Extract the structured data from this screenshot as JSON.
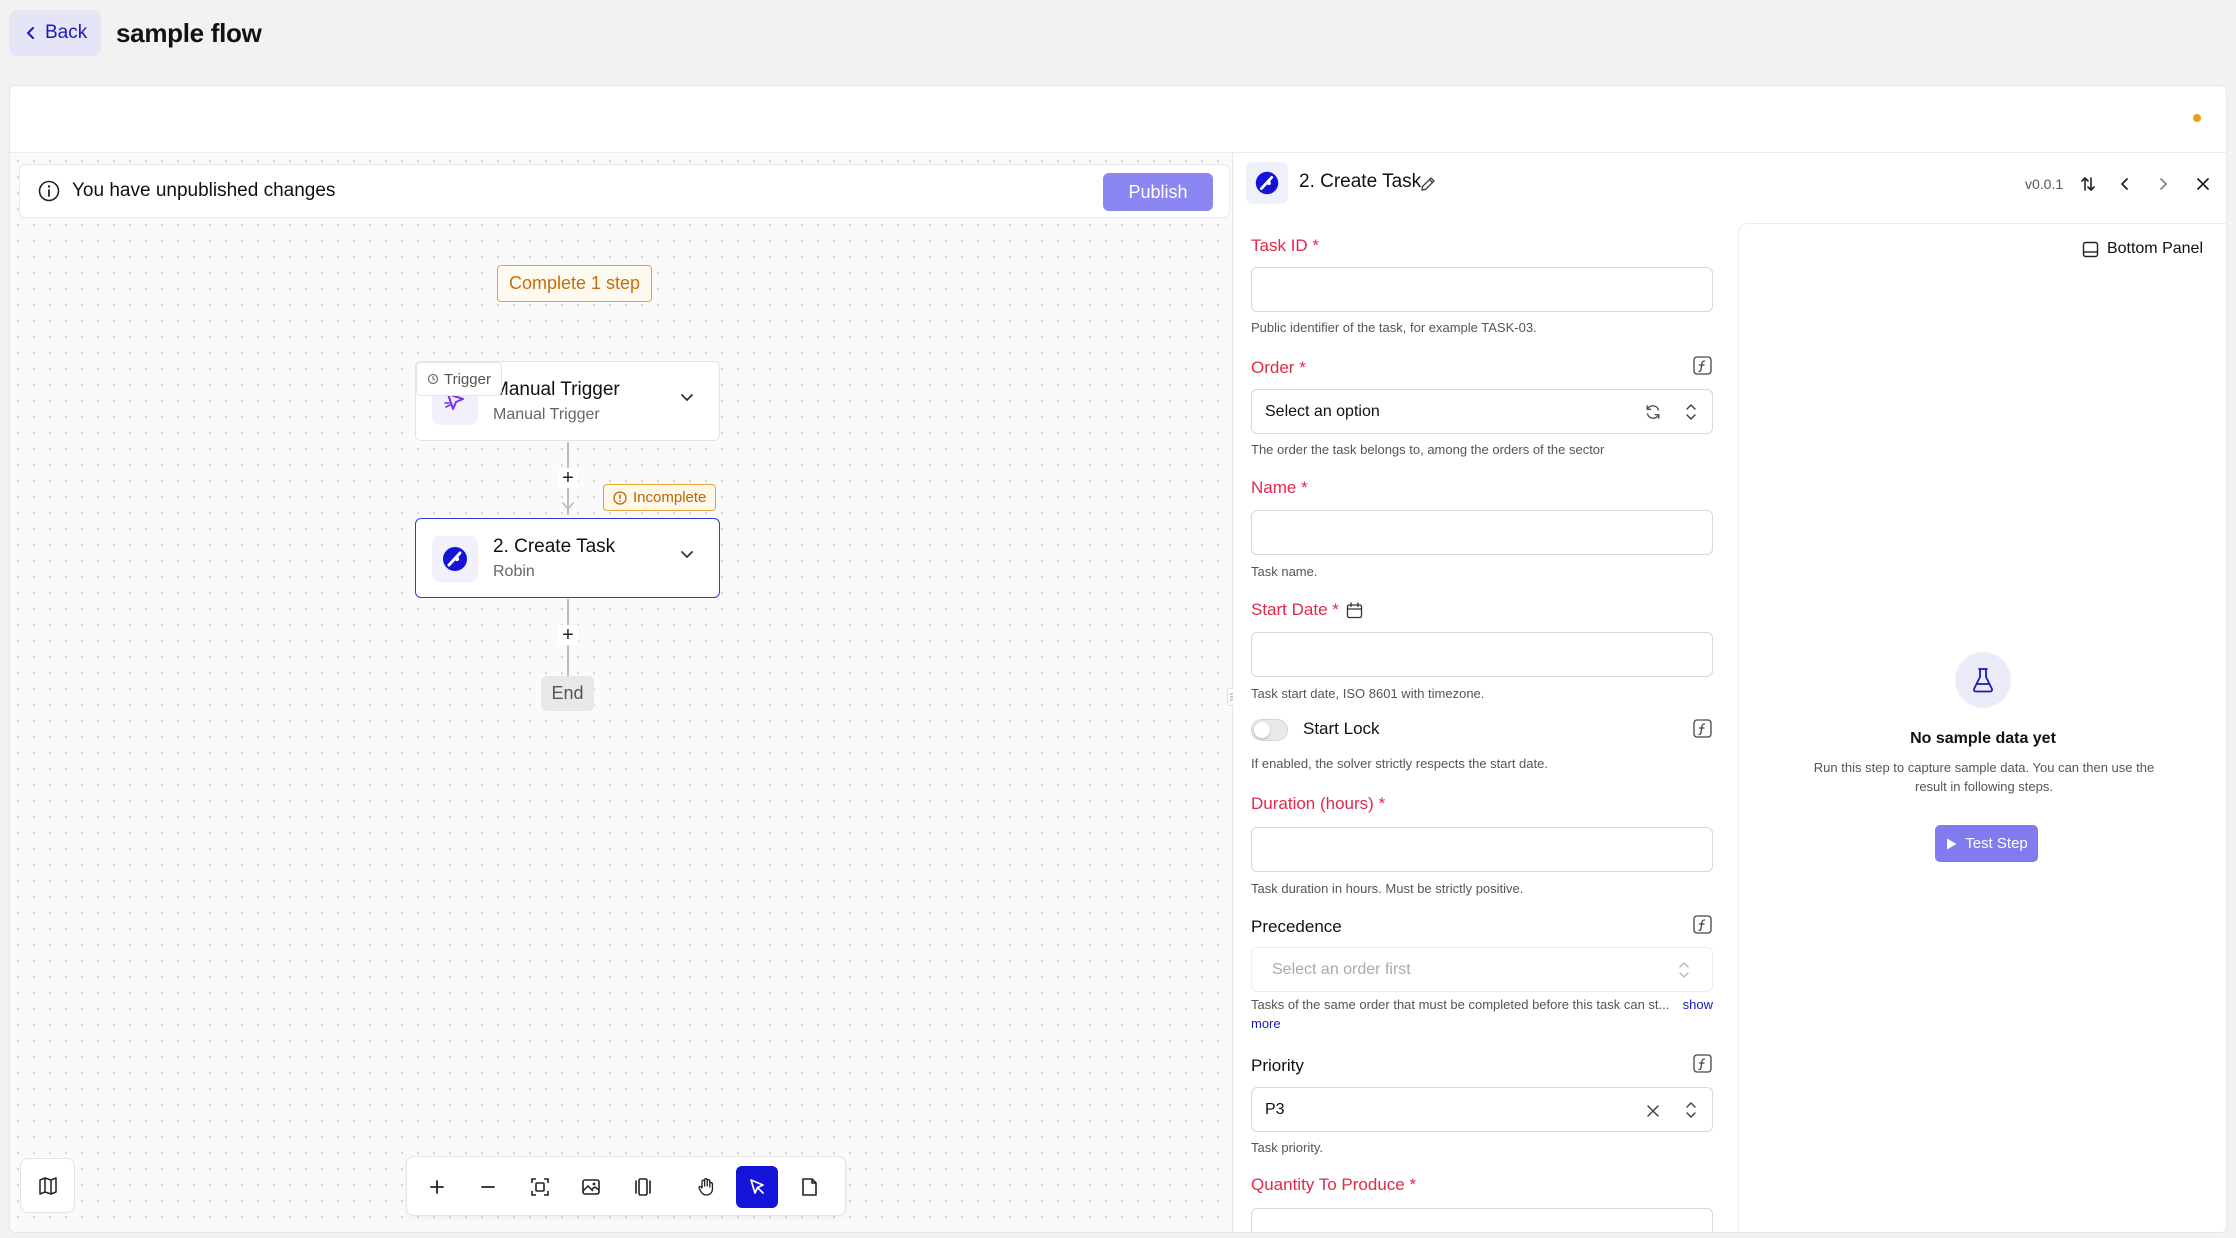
{
  "header": {
    "back_label": "Back",
    "flow_title": "sample flow"
  },
  "colors": {
    "accent": "#1414d9",
    "publish": "#8a86f2",
    "warning": "#e8a317",
    "required": "#e0294b"
  },
  "canvas": {
    "banner_text": "You have unpublished changes",
    "publish_label": "Publish",
    "complete_tag": "Complete 1 step",
    "trigger_node": {
      "tag": "Trigger",
      "title": "Manual Trigger",
      "subtitle": "Manual Trigger"
    },
    "step_node": {
      "title": "2. Create Task",
      "subtitle": "Robin",
      "status": "Incomplete"
    },
    "end_label": "End",
    "add_step_glyph": "+",
    "toolbar_icons": [
      "zoom-in-icon",
      "zoom-out-icon",
      "fit-view-icon",
      "export-image-icon",
      "layout-icon",
      "pan-hand-icon",
      "select-pointer-icon",
      "note-icon"
    ],
    "selected_tool": "select-pointer"
  },
  "panel": {
    "step_title": "2. Create Task",
    "version": "v0.0.1",
    "fields": {
      "task_id": {
        "label": "Task ID",
        "required_mark": "*",
        "value": "",
        "help": "Public identifier of the task, for example TASK-03."
      },
      "order": {
        "label": "Order",
        "required_mark": "*",
        "value": "Select an option",
        "help": "The order the task belongs to, among the orders of the sector"
      },
      "name": {
        "label": "Name",
        "required_mark": "*",
        "value": "",
        "help": "Task name."
      },
      "start_date": {
        "label": "Start Date",
        "required_mark": "*",
        "value": "",
        "help": "Task start date, ISO 8601 with timezone."
      },
      "start_lock": {
        "label": "Start Lock",
        "enabled": false,
        "help": "If enabled, the solver strictly respects the start date."
      },
      "duration": {
        "label": "Duration (hours)",
        "required_mark": "*",
        "value": "",
        "help": "Task duration in hours. Must be strictly positive."
      },
      "precedence": {
        "label": "Precedence",
        "placeholder": "Select an order first",
        "help": "Tasks of the same order that must be completed before this task can st...",
        "show_more_1": "show",
        "show_more_2": "more"
      },
      "priority": {
        "label": "Priority",
        "value": "P3",
        "help": "Task priority."
      },
      "quantity": {
        "label": "Quantity To Produce",
        "required_mark": "*"
      }
    },
    "result": {
      "bottom_panel_label": "Bottom Panel",
      "empty_title": "No sample data yet",
      "empty_desc": "Run this step to capture sample data. You can then use the result in following steps.",
      "test_label": "Test Step"
    }
  }
}
